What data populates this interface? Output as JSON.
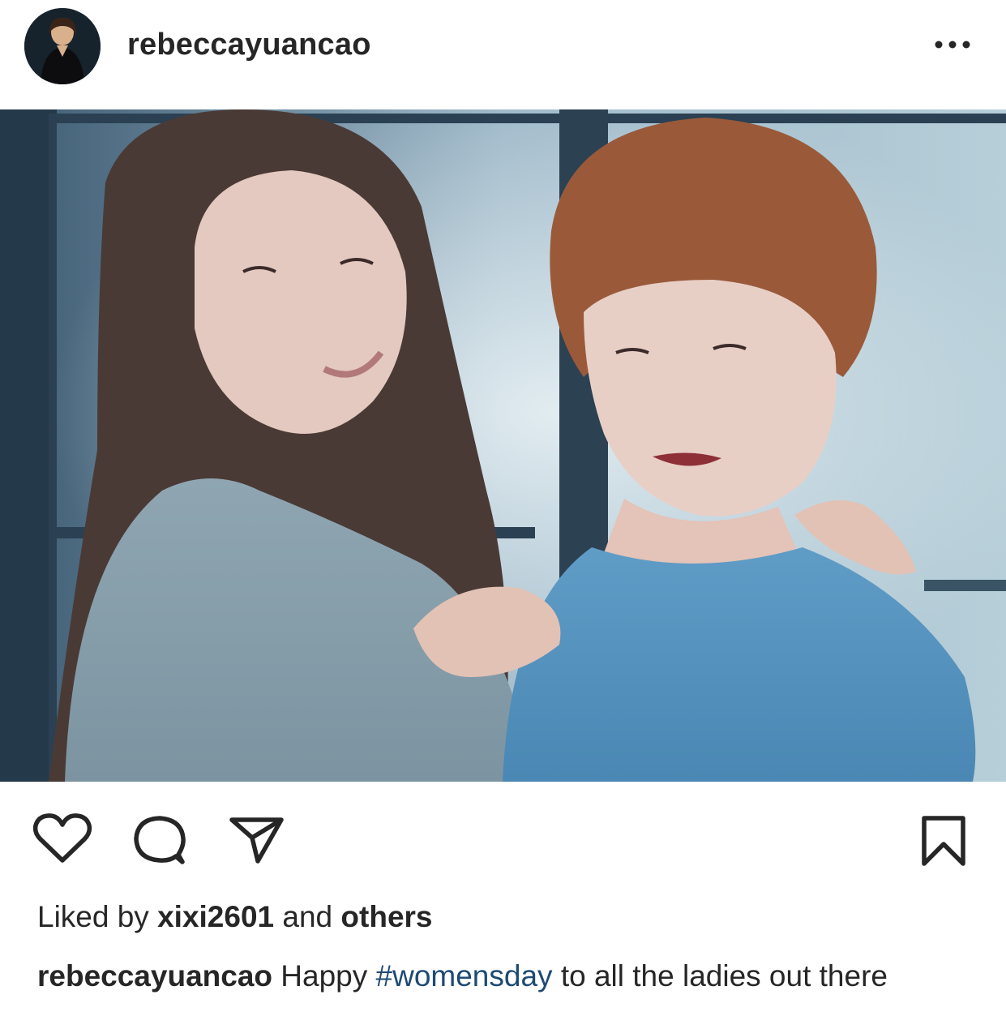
{
  "post": {
    "username": "rebeccayuancao",
    "more_icon": "more-horizontal-icon",
    "photo_alt": "photo"
  },
  "actions": {
    "like_icon": "heart-icon",
    "comment_icon": "comment-icon",
    "share_icon": "paper-plane-icon",
    "save_icon": "bookmark-icon"
  },
  "likes": {
    "prefix": "Liked by ",
    "user": "xixi2601",
    "and": " and ",
    "others": "others"
  },
  "caption": {
    "username": "rebeccayuancao",
    "text_before": " Happy ",
    "hashtag": "#womensday",
    "text_after": " to all the ladies out there"
  },
  "colors": {
    "text": "#262626",
    "hashtag": "#1e4a74",
    "background": "#ffffff"
  }
}
